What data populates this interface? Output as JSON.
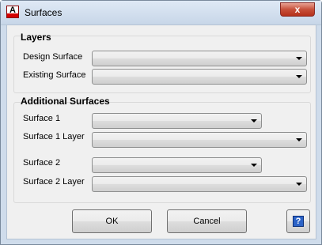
{
  "window": {
    "title": "Surfaces",
    "close_symbol": "x"
  },
  "layers": {
    "title": "Layers",
    "design_surface_label": "Design Surface",
    "existing_surface_label": "Existing Surface",
    "design_surface_value": "",
    "existing_surface_value": ""
  },
  "additional": {
    "title": "Additional Surfaces",
    "surface1_label": "Surface 1",
    "surface1_layer_label": "Surface 1 Layer",
    "surface2_label": "Surface 2",
    "surface2_layer_label": "Surface 2 Layer",
    "surface1_value": "",
    "surface1_layer_value": "",
    "surface2_value": "",
    "surface2_layer_value": ""
  },
  "buttons": {
    "ok": "OK",
    "cancel": "Cancel",
    "help": "?"
  },
  "icons": {
    "app": "autocad-app-icon",
    "help": "help-icon",
    "dropdown": "chevron-down-icon"
  },
  "colors": {
    "app_icon_red": "#d40000",
    "help_blue": "#2c63c7",
    "close_red": "#c7503a"
  }
}
